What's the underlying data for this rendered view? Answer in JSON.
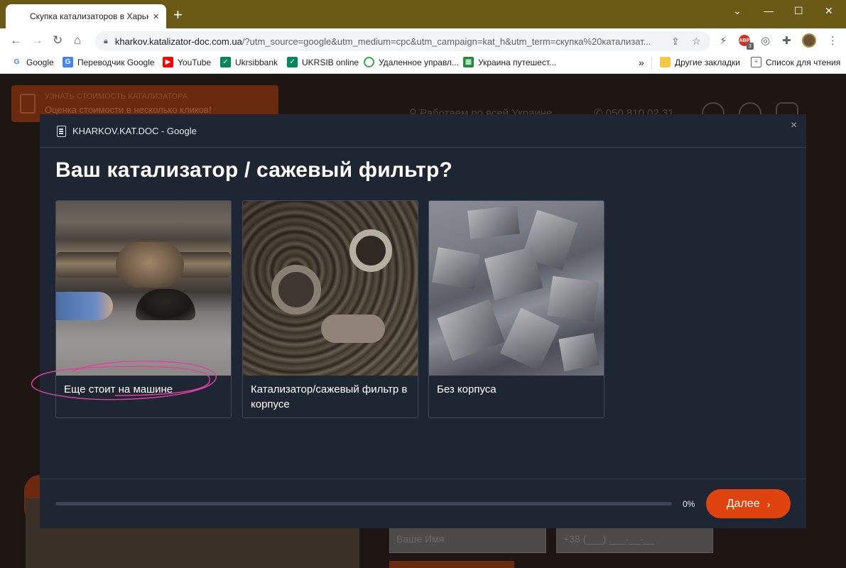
{
  "browser": {
    "tab_title": "Скупка катализаторов в Харько",
    "tab_close": "×",
    "new_tab": "+",
    "window_controls": {
      "collapse_tabs": "⌄",
      "minimize": "—",
      "maximize": "☐",
      "close": "✕"
    },
    "url_domain": "kharkov.katalizator-doc.com.ua",
    "url_path": "/?utm_source=google&utm_medium=cpc&utm_campaign=kat_h&utm_term=скупка%20катализат...",
    "bookmarks": [
      {
        "label": "Google",
        "icon": "google-icon",
        "color": "#4285f4"
      },
      {
        "label": "Переводчик Google",
        "icon": "translate-icon",
        "color": "#4285f4"
      },
      {
        "label": "YouTube",
        "icon": "youtube-icon",
        "color": "#ff0000"
      },
      {
        "label": "Ukrsibbank",
        "icon": "bank-icon",
        "color": "#00875a"
      },
      {
        "label": "UKRSIB online",
        "icon": "bank-icon",
        "color": "#00875a"
      },
      {
        "label": "Удаленное управл...",
        "icon": "remote-icon",
        "color": "#34a853"
      },
      {
        "label": "Украина путешест...",
        "icon": "travel-icon",
        "color": "#1e8e3e"
      }
    ],
    "bookmarks_more": "»",
    "other_bookmarks": "Другие закладки",
    "reading_list": "Список для чтения",
    "ext_badge_label": "ABP",
    "ext_badge_count": "3"
  },
  "site": {
    "cta_line1": "УЗНАТЬ СТОИМОСТЬ КАТАЛИЗАТОРА",
    "cta_line2": "Оценка стоимости в несколько кликов!",
    "coverage": "Работаем по всей Украине",
    "phone": "050 810 02 31",
    "name_placeholder": "Ваше Имя",
    "phone_placeholder": "+38 (___) ___-__-__"
  },
  "modal": {
    "header_title": "KHARKOV.KAT.DOC - Google",
    "close": "×",
    "question": "Ваш катализатор / сажевый фильтр?",
    "options": [
      {
        "label": "Еще стоит на машине",
        "image": "car-underbody-photo"
      },
      {
        "label": "Катализатор/сажевый фильтр в корпусе",
        "image": "scrap-catalysts-photo"
      },
      {
        "label": "Без корпуса",
        "image": "ceramic-blocks-photo"
      }
    ],
    "progress_value": 0,
    "progress_label": "0%",
    "next_label": "Далее",
    "next_chevron": "›",
    "accent_color": "#e0440e"
  }
}
